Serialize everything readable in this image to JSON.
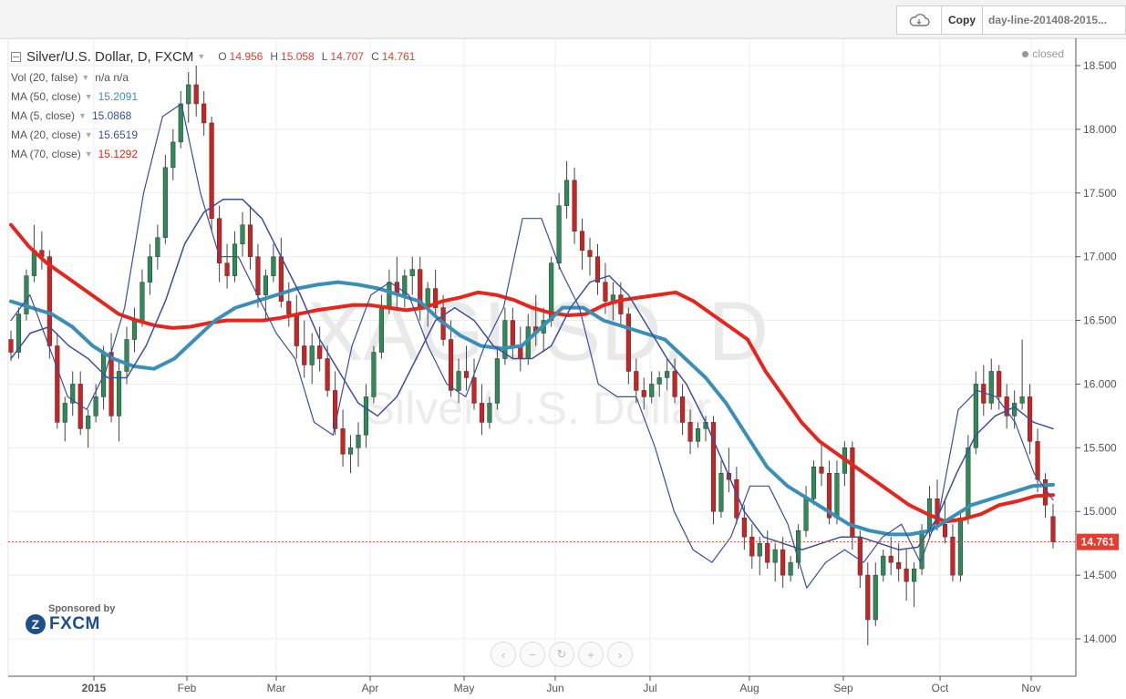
{
  "toolbar": {
    "cloud_icon": "cloud-icon",
    "copy_label": "Copy",
    "chart_name": "day-line-201408-2015..."
  },
  "legend": {
    "symbol": "Silver/U.S. Dollar, D, FXCM",
    "ohlc": {
      "o_key": "O",
      "o_val": "14.956",
      "h_key": "H",
      "h_val": "15.058",
      "l_key": "L",
      "l_val": "14.707",
      "c_key": "C",
      "c_val": "14.761"
    },
    "studies": [
      {
        "name": "Vol (20, false)",
        "value": "n/a  n/a",
        "color": "#555555"
      },
      {
        "name": "MA (50, close)",
        "value": "15.2091",
        "color": "#3a8fb7"
      },
      {
        "name": "MA (5, close)",
        "value": "15.0868",
        "color": "#3a4fa0"
      },
      {
        "name": "MA (20, close)",
        "value": "15.6519",
        "color": "#3a4fa0"
      },
      {
        "name": "MA (70, close)",
        "value": "15.1292",
        "color": "#e8251c"
      }
    ]
  },
  "status": "closed",
  "watermark": {
    "line1": "XAGUSD, D",
    "line2": "Silver/U.S. Dollar"
  },
  "sponsor": {
    "label": "Sponsored by",
    "brand": "FXCM"
  },
  "nav_buttons": [
    "‹",
    "−",
    "↻",
    "+",
    "›"
  ],
  "colors": {
    "up": "#2e8b57",
    "down": "#cc2222",
    "ma50": "#3a8fb7",
    "ma70": "#e8251c",
    "ma_thin": "#3a4fa0",
    "last_price": "#e63b2e"
  },
  "chart_data": {
    "type": "candlestick",
    "yticks": [
      "18.500",
      "18.000",
      "17.500",
      "17.000",
      "16.500",
      "16.000",
      "15.500",
      "15.000",
      "14.500",
      "14.000"
    ],
    "ylim": [
      13.95,
      18.6
    ],
    "xlabels": [
      "2015",
      "Feb",
      "Mar",
      "Apr",
      "May",
      "Jun",
      "Jul",
      "Aug",
      "Sep",
      "Oct",
      "Nov"
    ],
    "last_price": "14.761",
    "candles": [
      [
        16.35,
        16.42,
        16.18,
        16.25
      ],
      [
        16.25,
        16.6,
        16.2,
        16.55
      ],
      [
        16.55,
        16.9,
        16.5,
        16.85
      ],
      [
        16.85,
        17.25,
        16.8,
        17.05
      ],
      [
        17.05,
        17.2,
        16.9,
        17.0
      ],
      [
        17.0,
        17.05,
        16.2,
        16.3
      ],
      [
        16.3,
        16.4,
        15.65,
        15.7
      ],
      [
        15.7,
        15.9,
        15.55,
        15.85
      ],
      [
        15.85,
        16.1,
        15.75,
        16.0
      ],
      [
        16.0,
        16.1,
        15.6,
        15.65
      ],
      [
        15.65,
        15.8,
        15.5,
        15.75
      ],
      [
        15.75,
        16.0,
        15.7,
        15.9
      ],
      [
        15.9,
        16.3,
        15.8,
        16.25
      ],
      [
        16.25,
        16.4,
        15.7,
        15.75
      ],
      [
        15.75,
        16.2,
        15.55,
        16.1
      ],
      [
        16.1,
        16.45,
        16.0,
        16.35
      ],
      [
        16.35,
        16.6,
        16.25,
        16.5
      ],
      [
        16.5,
        16.9,
        16.45,
        16.8
      ],
      [
        16.8,
        17.1,
        16.7,
        17.0
      ],
      [
        17.0,
        17.25,
        16.9,
        17.15
      ],
      [
        17.15,
        17.8,
        17.1,
        17.7
      ],
      [
        17.7,
        18.0,
        17.6,
        17.9
      ],
      [
        17.9,
        18.3,
        17.85,
        18.2
      ],
      [
        18.2,
        18.45,
        18.05,
        18.35
      ],
      [
        18.35,
        18.5,
        18.1,
        18.2
      ],
      [
        18.2,
        18.3,
        17.95,
        18.05
      ],
      [
        18.05,
        18.1,
        17.2,
        17.3
      ],
      [
        17.3,
        17.4,
        16.8,
        16.95
      ],
      [
        16.95,
        17.1,
        16.75,
        16.85
      ],
      [
        16.85,
        17.2,
        16.8,
        17.1
      ],
      [
        17.1,
        17.35,
        17.0,
        17.25
      ],
      [
        17.25,
        17.4,
        16.9,
        17.0
      ],
      [
        17.0,
        17.1,
        16.6,
        16.7
      ],
      [
        16.7,
        16.9,
        16.5,
        16.85
      ],
      [
        16.85,
        17.1,
        16.8,
        17.0
      ],
      [
        17.0,
        17.15,
        16.6,
        16.65
      ],
      [
        16.65,
        16.8,
        16.45,
        16.55
      ],
      [
        16.55,
        16.7,
        16.2,
        16.3
      ],
      [
        16.3,
        16.5,
        16.05,
        16.15
      ],
      [
        16.15,
        16.4,
        16.0,
        16.3
      ],
      [
        16.3,
        16.45,
        16.1,
        16.2
      ],
      [
        16.2,
        16.3,
        15.9,
        15.95
      ],
      [
        15.95,
        16.1,
        15.6,
        15.65
      ],
      [
        15.65,
        15.8,
        15.35,
        15.45
      ],
      [
        15.45,
        15.6,
        15.3,
        15.5
      ],
      [
        15.5,
        15.7,
        15.35,
        15.6
      ],
      [
        15.6,
        16.0,
        15.5,
        15.9
      ],
      [
        15.9,
        16.3,
        15.85,
        16.25
      ],
      [
        16.25,
        16.7,
        16.2,
        16.6
      ],
      [
        16.6,
        16.9,
        16.55,
        16.8
      ],
      [
        16.8,
        17.0,
        16.6,
        16.7
      ],
      [
        16.7,
        16.9,
        16.6,
        16.85
      ],
      [
        16.85,
        17.0,
        16.7,
        16.9
      ],
      [
        16.9,
        17.0,
        16.5,
        16.6
      ],
      [
        16.6,
        16.8,
        16.45,
        16.75
      ],
      [
        16.75,
        16.9,
        16.55,
        16.6
      ],
      [
        16.6,
        16.7,
        16.3,
        16.35
      ],
      [
        16.35,
        16.5,
        15.9,
        15.95
      ],
      [
        15.95,
        16.2,
        15.85,
        16.1
      ],
      [
        16.1,
        16.3,
        15.95,
        16.05
      ],
      [
        16.05,
        16.2,
        15.8,
        15.85
      ],
      [
        15.85,
        16.0,
        15.6,
        15.7
      ],
      [
        15.7,
        15.9,
        15.65,
        15.85
      ],
      [
        15.85,
        16.3,
        15.8,
        16.2
      ],
      [
        16.2,
        16.6,
        16.15,
        16.5
      ],
      [
        16.5,
        16.6,
        16.2,
        16.3
      ],
      [
        16.3,
        16.45,
        16.1,
        16.2
      ],
      [
        16.2,
        16.55,
        16.15,
        16.45
      ],
      [
        16.45,
        16.7,
        16.3,
        16.4
      ],
      [
        16.4,
        16.6,
        16.25,
        16.5
      ],
      [
        16.5,
        17.0,
        16.45,
        16.95
      ],
      [
        16.95,
        17.5,
        16.9,
        17.4
      ],
      [
        17.4,
        17.75,
        17.3,
        17.6
      ],
      [
        17.6,
        17.7,
        17.1,
        17.2
      ],
      [
        17.2,
        17.3,
        16.9,
        17.05
      ],
      [
        17.05,
        17.15,
        16.85,
        17.0
      ],
      [
        17.0,
        17.1,
        16.7,
        16.8
      ],
      [
        16.8,
        16.95,
        16.55,
        16.65
      ],
      [
        16.65,
        16.8,
        16.5,
        16.7
      ],
      [
        16.7,
        16.8,
        16.45,
        16.55
      ],
      [
        16.55,
        16.6,
        16.0,
        16.1
      ],
      [
        16.1,
        16.2,
        15.85,
        15.95
      ],
      [
        15.95,
        16.05,
        15.8,
        15.9
      ],
      [
        15.9,
        16.1,
        15.85,
        16.0
      ],
      [
        16.0,
        16.1,
        15.9,
        16.05
      ],
      [
        16.05,
        16.2,
        15.95,
        16.1
      ],
      [
        16.1,
        16.2,
        15.85,
        15.9
      ],
      [
        15.9,
        16.0,
        15.6,
        15.7
      ],
      [
        15.7,
        15.8,
        15.45,
        15.55
      ],
      [
        15.55,
        15.7,
        15.5,
        15.65
      ],
      [
        15.65,
        15.75,
        15.55,
        15.7
      ],
      [
        15.7,
        15.75,
        14.9,
        15.0
      ],
      [
        15.0,
        15.4,
        14.95,
        15.3
      ],
      [
        15.3,
        15.5,
        15.15,
        15.25
      ],
      [
        15.25,
        15.35,
        14.9,
        14.95
      ],
      [
        14.95,
        15.05,
        14.7,
        14.8
      ],
      [
        14.8,
        14.9,
        14.55,
        14.65
      ],
      [
        14.65,
        14.8,
        14.5,
        14.75
      ],
      [
        14.75,
        14.85,
        14.55,
        14.6
      ],
      [
        14.6,
        14.75,
        14.45,
        14.7
      ],
      [
        14.7,
        14.8,
        14.4,
        14.5
      ],
      [
        14.5,
        14.65,
        14.45,
        14.6
      ],
      [
        14.6,
        14.9,
        14.55,
        14.85
      ],
      [
        14.85,
        15.2,
        14.8,
        15.1
      ],
      [
        15.1,
        15.4,
        15.05,
        15.35
      ],
      [
        15.35,
        15.55,
        15.2,
        15.3
      ],
      [
        15.3,
        15.4,
        14.9,
        14.95
      ],
      [
        14.95,
        15.4,
        14.9,
        15.3
      ],
      [
        15.3,
        15.55,
        15.2,
        15.5
      ],
      [
        15.5,
        15.55,
        14.7,
        14.8
      ],
      [
        14.8,
        14.85,
        14.4,
        14.5
      ],
      [
        14.5,
        14.6,
        13.95,
        14.15
      ],
      [
        14.15,
        14.6,
        14.1,
        14.5
      ],
      [
        14.5,
        14.7,
        14.45,
        14.65
      ],
      [
        14.65,
        14.8,
        14.5,
        14.6
      ],
      [
        14.6,
        14.75,
        14.45,
        14.55
      ],
      [
        14.55,
        14.7,
        14.3,
        14.45
      ],
      [
        14.45,
        14.6,
        14.25,
        14.55
      ],
      [
        14.55,
        14.9,
        14.5,
        14.85
      ],
      [
        14.85,
        15.2,
        14.8,
        15.1
      ],
      [
        15.1,
        15.25,
        14.85,
        14.9
      ],
      [
        14.9,
        15.1,
        14.75,
        14.8
      ],
      [
        14.8,
        14.9,
        14.45,
        14.5
      ],
      [
        14.5,
        15.0,
        14.45,
        14.95
      ],
      [
        14.95,
        15.6,
        14.9,
        15.5
      ],
      [
        15.5,
        16.1,
        15.45,
        16.0
      ],
      [
        16.0,
        16.15,
        15.75,
        15.85
      ],
      [
        15.85,
        16.2,
        15.8,
        16.1
      ],
      [
        16.1,
        16.15,
        15.8,
        15.9
      ],
      [
        15.9,
        16.0,
        15.65,
        15.75
      ],
      [
        15.75,
        15.95,
        15.65,
        15.85
      ],
      [
        15.85,
        16.35,
        15.8,
        15.9
      ],
      [
        15.9,
        16.0,
        15.45,
        15.55
      ],
      [
        15.55,
        15.65,
        15.15,
        15.25
      ],
      [
        15.25,
        15.3,
        14.95,
        15.05
      ],
      [
        14.96,
        15.06,
        14.71,
        14.76
      ]
    ],
    "series": [
      {
        "name": "MA (70, close)",
        "color": "#e8251c",
        "width": 4,
        "values": [
          17.25,
          17.08,
          16.95,
          16.85,
          16.75,
          16.65,
          16.55,
          16.5,
          16.46,
          16.44,
          16.45,
          16.48,
          16.5,
          16.5,
          16.5,
          16.52,
          16.55,
          16.58,
          16.6,
          16.62,
          16.62,
          16.6,
          16.58,
          16.6,
          16.65,
          16.68,
          16.72,
          16.7,
          16.66,
          16.6,
          16.56,
          16.54,
          16.55,
          16.62,
          16.66,
          16.68,
          16.7,
          16.72,
          16.65,
          16.55,
          16.45,
          16.35,
          16.1,
          15.9,
          15.7,
          15.55,
          15.45,
          15.35,
          15.25,
          15.15,
          15.05,
          14.98,
          14.92,
          14.94,
          14.98,
          15.05,
          15.08,
          15.12,
          15.13
        ]
      },
      {
        "name": "MA (50, close)",
        "color": "#3a8fb7",
        "width": 4,
        "values": [
          16.65,
          16.6,
          16.55,
          16.45,
          16.3,
          16.2,
          16.14,
          16.12,
          16.2,
          16.35,
          16.5,
          16.6,
          16.65,
          16.7,
          16.75,
          16.78,
          16.8,
          16.78,
          16.75,
          16.7,
          16.65,
          16.5,
          16.38,
          16.3,
          16.28,
          16.3,
          16.45,
          16.6,
          16.6,
          16.5,
          16.45,
          16.4,
          16.35,
          16.2,
          16.05,
          15.85,
          15.6,
          15.35,
          15.2,
          15.1,
          15.0,
          14.9,
          14.85,
          14.82,
          14.82,
          14.85,
          14.95,
          15.05,
          15.1,
          15.15,
          15.2,
          15.21
        ]
      },
      {
        "name": "MA (20, close)",
        "color": "#3a4fa0",
        "width": 1.5,
        "values": [
          16.2,
          16.4,
          16.45,
          16.3,
          16.2,
          16.05,
          16.05,
          16.3,
          16.65,
          17.1,
          17.35,
          17.45,
          17.45,
          17.3,
          17.0,
          16.7,
          16.35,
          16.1,
          15.85,
          15.75,
          15.9,
          16.2,
          16.5,
          16.6,
          16.5,
          16.3,
          16.2,
          16.2,
          16.3,
          16.6,
          16.8,
          16.85,
          16.7,
          16.45,
          16.2,
          16.0,
          15.7,
          15.35,
          15.0,
          14.8,
          14.75,
          14.7,
          14.75,
          14.8,
          14.8,
          14.75,
          14.7,
          14.72,
          14.95,
          15.3,
          15.6,
          15.75,
          15.82,
          15.7,
          15.65
        ]
      },
      {
        "name": "MA (5, close)",
        "color": "#3a4fa0",
        "width": 1.2,
        "values": [
          16.5,
          16.7,
          16.3,
          15.9,
          15.8,
          16.1,
          16.6,
          17.5,
          18.1,
          18.2,
          17.5,
          17.0,
          17.0,
          16.7,
          16.4,
          16.2,
          15.7,
          15.6,
          16.3,
          16.7,
          16.8,
          16.7,
          16.3,
          16.0,
          15.9,
          16.3,
          16.6,
          17.3,
          17.3,
          16.9,
          16.6,
          16.0,
          15.9,
          15.9,
          15.5,
          15.0,
          14.7,
          14.6,
          14.8,
          15.2,
          15.2,
          14.9,
          14.4,
          14.6,
          14.7,
          14.6,
          14.8,
          14.9,
          14.6,
          15.0,
          15.8,
          15.95,
          15.9,
          15.7,
          15.3,
          15.09
        ]
      }
    ]
  }
}
